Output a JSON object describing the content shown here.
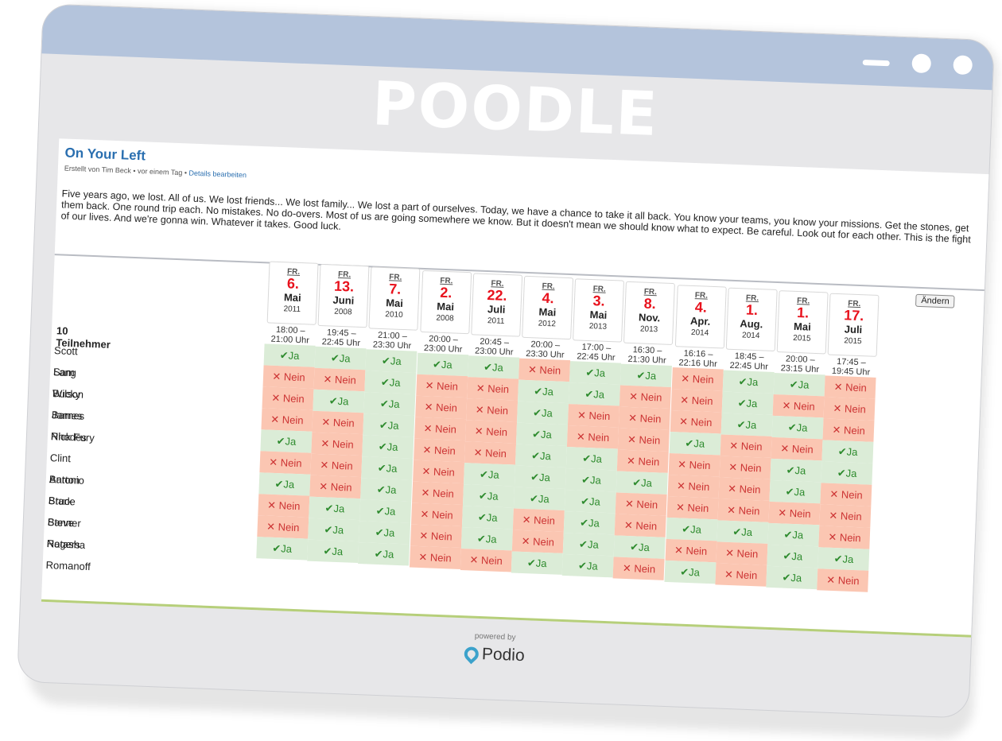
{
  "brand": "POODLE",
  "poll": {
    "title": "On Your Left",
    "meta": "Erstellt von Tim Beck • vor einem Tag •",
    "edit_link": "Details bearbeiten",
    "description": "Five years ago, we lost. All of us. We lost friends... We lost family... We lost a part of ourselves. Today, we have a chance to take it all back. You know your teams, you know your missions. Get the stones, get them back. One round trip each. No mistakes. No do-overs. Most of us are going somewhere we know. But it doesn't mean we should know what to expect. Be careful. Look out for each other. This is the fight of our lives. And we're gonna win. Whatever it takes. Good luck.",
    "participants_count": "10 Teilnehmer",
    "change_button": "Ändern"
  },
  "dates": [
    {
      "dow": "FR.",
      "day": "6.",
      "month": "Mai",
      "year": "2011",
      "time": "18:00 – 21:00 Uhr"
    },
    {
      "dow": "FR.",
      "day": "13.",
      "month": "Juni",
      "year": "2008",
      "time": "19:45 – 22:45 Uhr"
    },
    {
      "dow": "FR.",
      "day": "7.",
      "month": "Mai",
      "year": "2010",
      "time": "21:00 – 23:30 Uhr"
    },
    {
      "dow": "FR.",
      "day": "2.",
      "month": "Mai",
      "year": "2008",
      "time": "20:00 – 23:00 Uhr"
    },
    {
      "dow": "FR.",
      "day": "22.",
      "month": "Juli",
      "year": "2011",
      "time": "20:45 – 23:00 Uhr"
    },
    {
      "dow": "FR.",
      "day": "4.",
      "month": "Mai",
      "year": "2012",
      "time": "20:00 – 23:30 Uhr"
    },
    {
      "dow": "FR.",
      "day": "3.",
      "month": "Mai",
      "year": "2013",
      "time": "17:00 – 22:45 Uhr"
    },
    {
      "dow": "FR.",
      "day": "8.",
      "month": "Nov.",
      "year": "2013",
      "time": "16:30 – 21:30 Uhr"
    },
    {
      "dow": "FR.",
      "day": "4.",
      "month": "Apr.",
      "year": "2014",
      "time": "16:16 – 22:16 Uhr"
    },
    {
      "dow": "FR.",
      "day": "1.",
      "month": "Aug.",
      "year": "2014",
      "time": "18:45 – 22:45 Uhr"
    },
    {
      "dow": "FR.",
      "day": "1.",
      "month": "Mai",
      "year": "2015",
      "time": "20:00 – 23:15 Uhr"
    },
    {
      "dow": "FR.",
      "day": "17.",
      "month": "Juli",
      "year": "2015",
      "time": "17:45 – 19:45 Uhr"
    }
  ],
  "participants": [
    {
      "name": "Scott Lang",
      "votes": [
        "✔Ja",
        "✔Ja",
        "✔Ja",
        "✔Ja",
        "✔Ja",
        "✕ Nein",
        "✔Ja",
        "✔Ja",
        "✕ Nein",
        "✔Ja",
        "✔Ja",
        "✕ Nein"
      ]
    },
    {
      "name": "Sam Wilson",
      "votes": [
        "✕ Nein",
        "✕ Nein",
        "✔Ja",
        "✕ Nein",
        "✕ Nein",
        "✔Ja",
        "✔Ja",
        "✕ Nein",
        "✕ Nein",
        "✔Ja",
        "✕ Nein",
        "✕ Nein"
      ]
    },
    {
      "name": "Bucky Barnes",
      "votes": [
        "✕ Nein",
        "✔Ja",
        "✔Ja",
        "✕ Nein",
        "✕ Nein",
        "✔Ja",
        "✕ Nein",
        "✕ Nein",
        "✕ Nein",
        "✔Ja",
        "✔Ja",
        "✕ Nein"
      ]
    },
    {
      "name": "James Rhodes",
      "votes": [
        "✕ Nein",
        "✕ Nein",
        "✔Ja",
        "✕ Nein",
        "✕ Nein",
        "✔Ja",
        "✕ Nein",
        "✕ Nein",
        "✔Ja",
        "✕ Nein",
        "✕ Nein",
        "✔Ja"
      ]
    },
    {
      "name": "Nick Fury",
      "votes": [
        "✔Ja",
        "✕ Nein",
        "✔Ja",
        "✕ Nein",
        "✕ Nein",
        "✔Ja",
        "✔Ja",
        "✕ Nein",
        "✕ Nein",
        "✕ Nein",
        "✔Ja",
        "✔Ja"
      ]
    },
    {
      "name": "Clint Barton",
      "votes": [
        "✕ Nein",
        "✕ Nein",
        "✔Ja",
        "✕ Nein",
        "✔Ja",
        "✔Ja",
        "✔Ja",
        "✔Ja",
        "✕ Nein",
        "✕ Nein",
        "✔Ja",
        "✕ Nein"
      ]
    },
    {
      "name": "Antonio Stark",
      "votes": [
        "✔Ja",
        "✕ Nein",
        "✔Ja",
        "✕ Nein",
        "✔Ja",
        "✔Ja",
        "✔Ja",
        "✕ Nein",
        "✕ Nein",
        "✕ Nein",
        "✕ Nein",
        "✕ Nein"
      ]
    },
    {
      "name": "Bruce Banner",
      "votes": [
        "✕ Nein",
        "✔Ja",
        "✔Ja",
        "✕ Nein",
        "✔Ja",
        "✕ Nein",
        "✔Ja",
        "✕ Nein",
        "✔Ja",
        "✔Ja",
        "✔Ja",
        "✕ Nein"
      ]
    },
    {
      "name": "Steve Rogers",
      "votes": [
        "✕ Nein",
        "✔Ja",
        "✔Ja",
        "✕ Nein",
        "✔Ja",
        "✕ Nein",
        "✔Ja",
        "✔Ja",
        "✕ Nein",
        "✕ Nein",
        "✔Ja",
        "✔Ja"
      ]
    },
    {
      "name": "Natasha Romanoff",
      "votes": [
        "✔Ja",
        "✔Ja",
        "✔Ja",
        "✕ Nein",
        "✕ Nein",
        "✔Ja",
        "✔Ja",
        "✕ Nein",
        "✔Ja",
        "✕ Nein",
        "✔Ja",
        "✕ Nein"
      ]
    }
  ],
  "footer": {
    "powered_by": "powered by",
    "provider": "Podio"
  },
  "colors": {
    "titlebar": "#b4c4dc",
    "ja": "#dbecd7",
    "nein": "#fbc6b2",
    "accent": "#e8121d",
    "link": "#2a6fb0"
  }
}
